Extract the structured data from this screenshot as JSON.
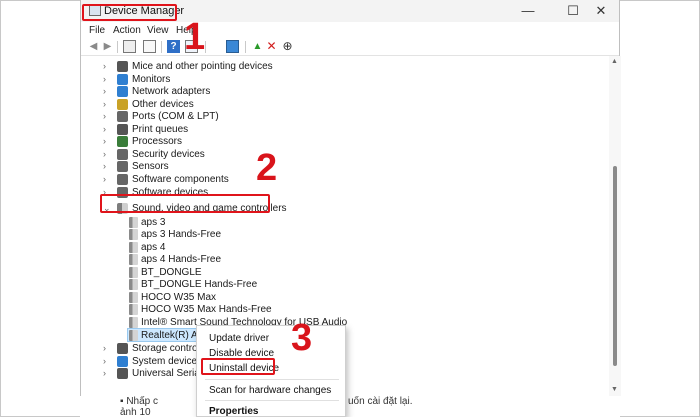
{
  "window": {
    "title": "Device Manager",
    "controls": {
      "minimize": "—",
      "maximize": "☐",
      "close": "✕"
    }
  },
  "menu": [
    "File",
    "Action",
    "View",
    "Help"
  ],
  "toolbar_icons": [
    "back-arrow-icon",
    "forward-arrow-icon",
    "properties-icon",
    "view-icon",
    "help-icon",
    "show-hidden-icon",
    "scan-icon",
    "monitor-icon",
    "enable-device-icon",
    "uninstall-x-icon",
    "update-driver-icon"
  ],
  "tree": {
    "categories_top": [
      {
        "label": "Mice and other pointing devices",
        "icon": "mouse-icon",
        "color": "#555555"
      },
      {
        "label": "Monitors",
        "icon": "monitor-icon",
        "color": "#2f7fd1"
      },
      {
        "label": "Network adapters",
        "icon": "network-icon",
        "color": "#2f7fd1"
      },
      {
        "label": "Other devices",
        "icon": "unknown-device-icon",
        "color": "#c9a227"
      },
      {
        "label": "Ports (COM & LPT)",
        "icon": "port-icon",
        "color": "#666666"
      },
      {
        "label": "Print queues",
        "icon": "printer-icon",
        "color": "#555555"
      },
      {
        "label": "Processors",
        "icon": "chip-icon",
        "color": "#3a7d3a"
      },
      {
        "label": "Security devices",
        "icon": "security-icon",
        "color": "#666666"
      },
      {
        "label": "Sensors",
        "icon": "sensor-icon",
        "color": "#666666"
      },
      {
        "label": "Software components",
        "icon": "component-icon",
        "color": "#666666"
      },
      {
        "label": "Software devices",
        "icon": "software-icon",
        "color": "#666666"
      }
    ],
    "expanded": {
      "label": "Sound, video and game controllers",
      "icon": "speaker-icon"
    },
    "children": [
      "aps 3",
      "aps 3 Hands-Free",
      "aps 4",
      "aps 4 Hands-Free",
      "BT_DONGLE",
      "BT_DONGLE Hands-Free",
      "HOCO W35 Max",
      "HOCO W35 Max Hands-Free",
      "Intel® Smart Sound Technology for USB Audio",
      "Realtek(R) A"
    ],
    "categories_bottom": [
      {
        "label": "Storage control",
        "icon": "storage-icon",
        "color": "#555555"
      },
      {
        "label": "System devices",
        "icon": "system-icon",
        "color": "#2f7fd1"
      },
      {
        "label": "Universal Serial",
        "icon": "usb-icon",
        "color": "#555555"
      }
    ]
  },
  "context_menu": {
    "update_driver": "Update driver",
    "disable_device": "Disable device",
    "uninstall_device": "Uninstall device",
    "scan": "Scan for hardware changes",
    "properties": "Properties"
  },
  "annotations": {
    "step1": "1",
    "step2": "2",
    "step3": "3"
  },
  "background_text": {
    "line1": "▪  Nhấp c",
    "line1_tail": "uốn cài đặt lại.",
    "line2": "ảnh 10"
  }
}
